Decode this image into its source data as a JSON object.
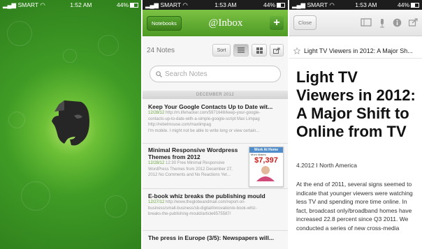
{
  "left": {
    "status": {
      "carrier": "SMART",
      "time": "1:52 AM",
      "battery": "44%"
    }
  },
  "middle": {
    "status": {
      "carrier": "SMART",
      "time": "1:53 AM",
      "battery": "44%"
    },
    "header": {
      "notebooks_label": "Notebooks",
      "title": "@Inbox",
      "add_label": "+"
    },
    "toolbar": {
      "notes_count": "24 Notes",
      "sort_label": "Sort"
    },
    "search": {
      "placeholder": "Search Notes"
    },
    "date_header": "DECEMBER 2012",
    "notes": [
      {
        "title": "Keep Your Google Contacts Up to Date wit...",
        "meta_date": "12/28/12",
        "meta_line1": "http://m.lifehacker.com/5971648/keep-your-google-",
        "meta_line2": "contacts-up-to-date-with-a-simple-google-script Max Limpag",
        "meta_line3": "http://rebelmouse.com/maxlimpag",
        "meta_line4": "I'm mobile. I might not be able to write long or view certain..."
      },
      {
        "title": "Minimal Responsive Wordpress Themes from 2012",
        "meta_date": "12/28/12",
        "meta_line1": "12:30 Free Minimal Responsive",
        "meta_line2": "WordPress Themes from 2012 December 27,",
        "meta_line3": "2012 No Comments and No Reactions Yet..."
      },
      {
        "title": "E-book whiz breaks the publishing mould",
        "meta_date": "12/27/12",
        "meta_line1": "http://www.theglobeandmail.com/report-on-",
        "meta_line2": "business/small-business/sb-digital/innovation/e-book-whiz-",
        "meta_line3": "breaks-the-publishing-mould/article6575587/"
      },
      {
        "title": "The press in Europe (3/5): Newspapers will..."
      }
    ],
    "thumb": {
      "top": "Work At Home",
      "number": "$7,397",
      "sub": "Mom Makes"
    }
  },
  "right": {
    "status": {
      "carrier": "SMART",
      "time": "1:53 AM",
      "battery": "44%"
    },
    "header": {
      "close_label": "Close"
    },
    "title_bar": "Light TV Viewers in 2012: A Major Sh...",
    "headline": "Light TV Viewers in 2012: A Major Shift to Online from TV",
    "byline": "4.2012 I North America",
    "body": "At the end of 2011, several signs seemed to indicate that younger viewers were watching less TV and spending more time online. In fact, broadcast only/broadband homes have increased 22.8 percent since Q3 2011. We conducted a series of new cross-media"
  },
  "colors": {
    "evernote_green": "#4d9a25",
    "date_green": "#68a43a"
  }
}
